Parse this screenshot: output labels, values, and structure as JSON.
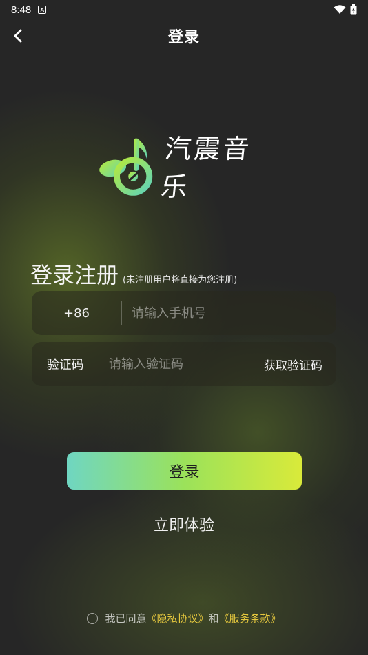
{
  "status_bar": {
    "time": "8:48",
    "notification_icon": "A",
    "icons": [
      "wifi-icon",
      "battery-charging-icon"
    ]
  },
  "header": {
    "title": "登录",
    "back_icon": "chevron-left-icon"
  },
  "logo": {
    "text": "汽震音乐",
    "icon": "music-note-disc-icon"
  },
  "form": {
    "title": "登录注册",
    "note": "(未注册用户将直接为您注册)",
    "phone": {
      "prefix": "+86",
      "placeholder": "请输入手机号",
      "value": ""
    },
    "code": {
      "label": "验证码",
      "placeholder": "请输入验证码",
      "value": "",
      "get_code_label": "获取验证码"
    }
  },
  "actions": {
    "login_label": "登录",
    "try_label": "立即体验"
  },
  "agreement": {
    "prefix": "我已同意",
    "privacy_link": "《隐私协议》",
    "conjunction": "和",
    "terms_link": "《服务条款》",
    "checked": false
  },
  "colors": {
    "background": "#262626",
    "accent_yellow": "#e6c83e",
    "button_gradient": [
      "#6fd6c2",
      "#9be25a",
      "#d9ea3a"
    ]
  }
}
